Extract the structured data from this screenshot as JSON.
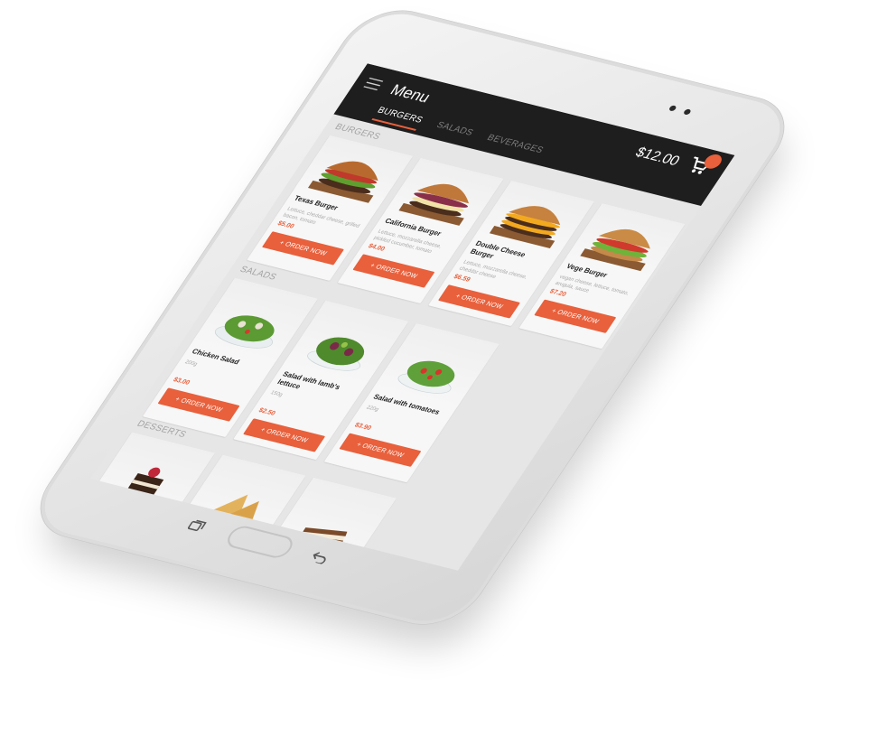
{
  "app": {
    "title": "Menu",
    "cart_total": "$12.00",
    "cart_badge": "",
    "accent": "#e8603c",
    "bar_color": "#1e1e1e"
  },
  "tabs": [
    {
      "label": "BURGERS",
      "active": true
    },
    {
      "label": "SALADS",
      "active": false
    },
    {
      "label": "BEVERAGES",
      "active": false
    }
  ],
  "sections": {
    "burgers": {
      "title": "BURGERS",
      "items": [
        {
          "name": "Texas Burger",
          "desc": "Lettuce, cheddar cheese, grilled bacon, tomato",
          "price": "$5.00",
          "button": "+ ORDER NOW",
          "icon": "burger-image"
        },
        {
          "name": "California Burger",
          "desc": "Lettuce, mozzarella cheese, pickled cucumber, tomato",
          "price": "$4.00",
          "button": "+ ORDER NOW",
          "icon": "burger-image"
        },
        {
          "name": "Double Cheese Burger",
          "desc": "Lettuce, mozzarella cheese, cheddar cheese",
          "price": "$6.59",
          "button": "+ ORDER NOW",
          "icon": "burger-image"
        },
        {
          "name": "Vege Burger",
          "desc": "vegan cheese, lettuce, tomato, arugula, sauce",
          "price": "$7.20",
          "button": "+ ORDER NOW",
          "icon": "burger-image"
        }
      ]
    },
    "salads": {
      "title": "SALADS",
      "items": [
        {
          "name": "Chicken Salad",
          "desc": "200g",
          "price": "$3.00",
          "button": "+ ORDER NOW",
          "icon": "salad-image"
        },
        {
          "name": "Salad with lamb's lettuce",
          "desc": "150g",
          "price": "$2.50",
          "button": "+ ORDER NOW",
          "icon": "salad-image"
        },
        {
          "name": "Salad with tomatoes",
          "desc": "220g",
          "price": "$3.90",
          "button": "+ ORDER NOW",
          "icon": "salad-image"
        }
      ]
    },
    "desserts": {
      "title": "DESSERTS",
      "items": [
        {
          "icon": "cake-image"
        },
        {
          "icon": "tart-image"
        },
        {
          "icon": "cake-slice-image"
        }
      ]
    }
  }
}
